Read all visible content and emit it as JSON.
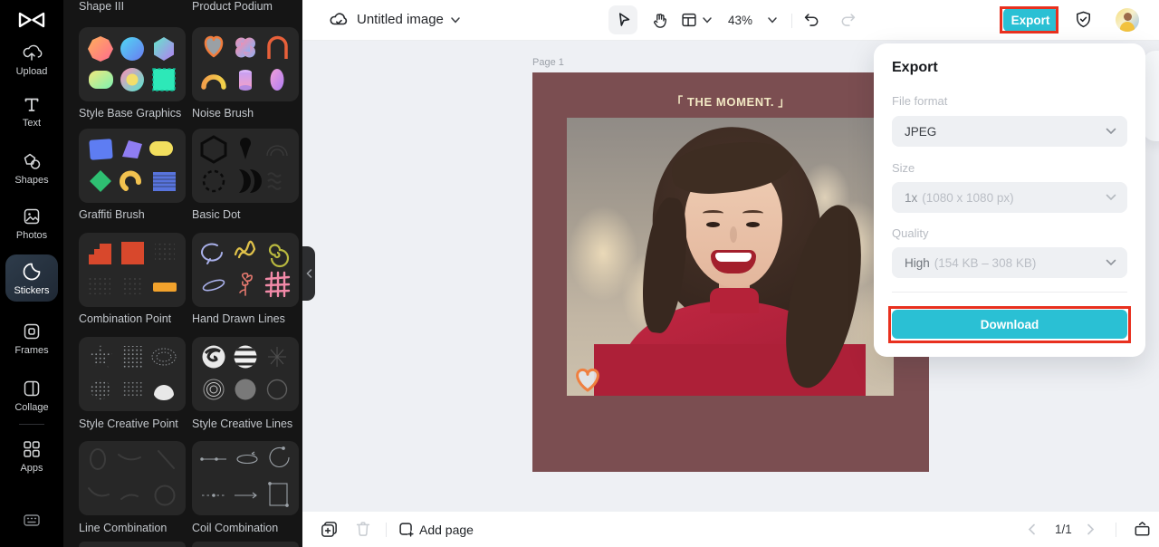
{
  "colors": {
    "accent_cyan": "#2ac0d4",
    "annotation_red": "#e8301e",
    "canvas_background_mauve": "#7b4e51",
    "canvas_title_cream": "#f2e8c4",
    "sidebar_selected_bg": "#28313c"
  },
  "left_toolbar": {
    "items": [
      {
        "label": "Upload"
      },
      {
        "label": "Text"
      },
      {
        "label": "Shapes"
      },
      {
        "label": "Photos"
      },
      {
        "label": "Stickers",
        "selected": true
      },
      {
        "label": "Frames"
      },
      {
        "label": "Collage"
      },
      {
        "label": "Apps"
      }
    ]
  },
  "stickers_panel": {
    "top_row_labels": [
      {
        "label": "Shape III"
      },
      {
        "label": "Product Podium"
      }
    ],
    "groups": [
      {
        "label": "Style Base Graphics"
      },
      {
        "label": "Noise Brush"
      },
      {
        "label": "Graffiti Brush"
      },
      {
        "label": "Basic Dot"
      },
      {
        "label": "Combination Point"
      },
      {
        "label": "Hand Drawn Lines"
      },
      {
        "label": "Style Creative Point"
      },
      {
        "label": "Style Creative Lines"
      },
      {
        "label": "Line Combination"
      },
      {
        "label": "Coil Combination"
      }
    ]
  },
  "topbar": {
    "document_title": "Untitled image",
    "zoom_level": "43%",
    "export_button": "Export"
  },
  "canvas": {
    "page_label": "Page 1",
    "design_text": "「 THE MOMENT. 」"
  },
  "export_panel": {
    "title": "Export",
    "file_format": {
      "label": "File format",
      "value": "JPEG"
    },
    "size": {
      "label": "Size",
      "value": "1x",
      "detail": "(1080 x 1080 px)"
    },
    "quality": {
      "label": "Quality",
      "value": "High",
      "detail": "(154 KB – 308 KB)"
    },
    "download_button": "Download"
  },
  "bottombar": {
    "add_page_label": "Add page",
    "page_indicator": "1/1"
  },
  "icons": [
    "app-logo",
    "upload-icon",
    "text-icon",
    "shapes-icon",
    "photos-icon",
    "stickers-icon",
    "frames-icon",
    "collage-icon",
    "apps-icon",
    "keyboard-icon",
    "cloud-synced-icon",
    "chevron-down-icon",
    "cursor-icon",
    "hand-icon",
    "layout-icon",
    "undo-icon",
    "redo-icon",
    "shield-check-icon",
    "avatar",
    "collapse-panel-icon",
    "heart-sticker",
    "pages-icon",
    "trash-icon",
    "add-page-icon",
    "chevron-left-icon",
    "chevron-right-icon",
    "present-icon"
  ]
}
